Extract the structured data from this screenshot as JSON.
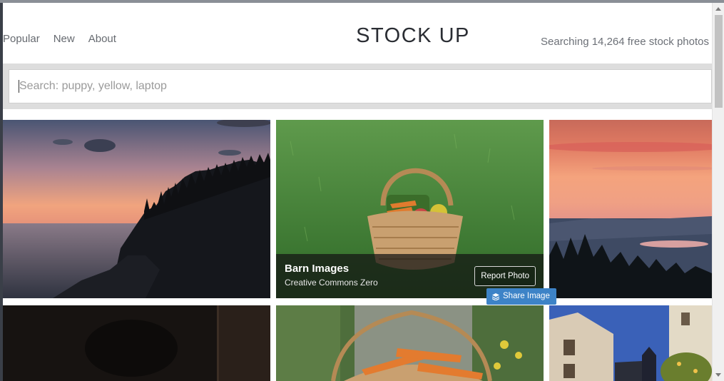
{
  "header": {
    "nav": [
      "Popular",
      "New",
      "About"
    ],
    "brand": "STOCK UP",
    "count_text": "Searching 14,264 free stock photos"
  },
  "search": {
    "placeholder": "Search: puppy, yellow, laptop",
    "value": ""
  },
  "photos": [
    {
      "description": "sunset over rocky coast"
    },
    {
      "description": "basket of vegetables on grass",
      "author": "Barn Images",
      "license": "Creative Commons Zero",
      "report_label": "Report Photo",
      "share_label": "Share Image"
    },
    {
      "description": "sunset over mountain lake"
    },
    {
      "description": "dark cat portrait"
    },
    {
      "description": "person holding basket of carrots"
    },
    {
      "description": "town square at dusk"
    }
  ],
  "colors": {
    "share_button": "#3d83c7",
    "brand_text": "#2a2d33"
  },
  "icons": {
    "share": "layers-icon",
    "scroll_up": "arrow-up-icon",
    "scroll_down": "arrow-down-icon"
  }
}
